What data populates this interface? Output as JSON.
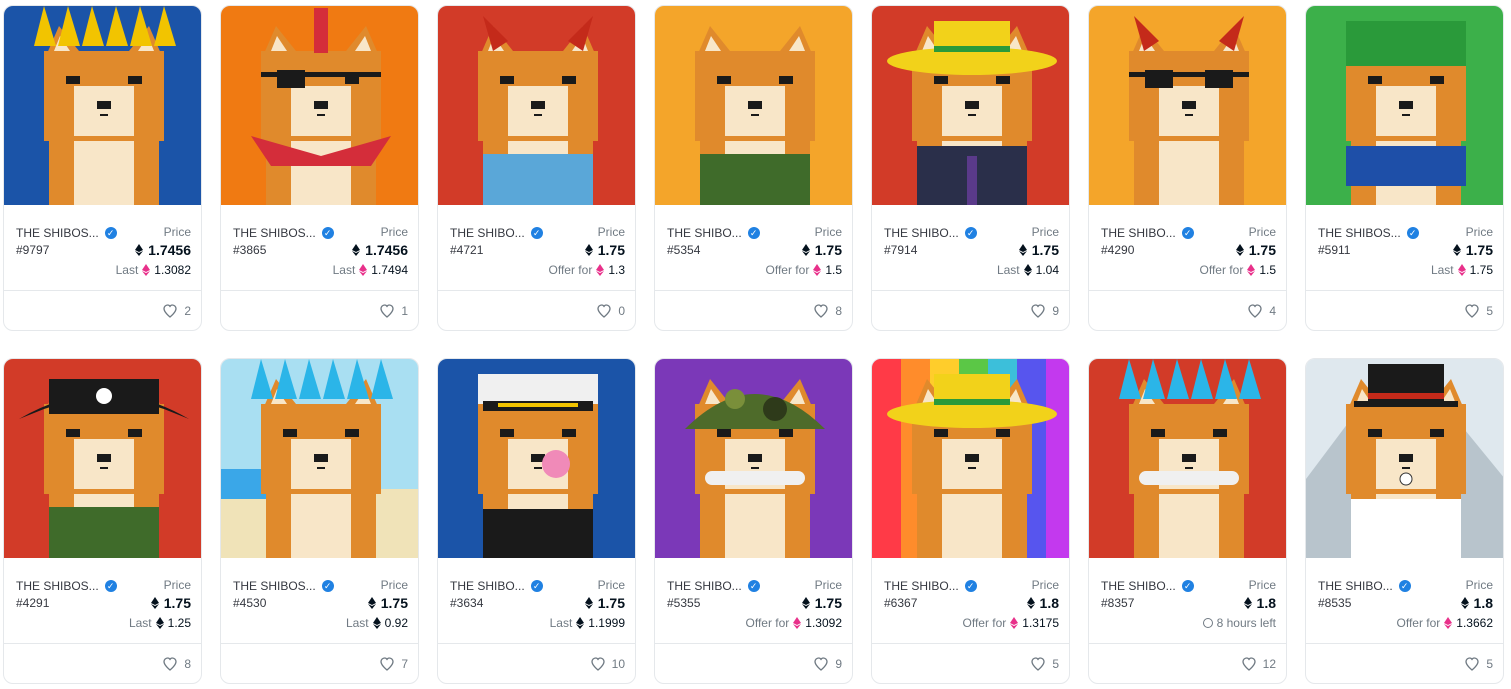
{
  "cards": [
    {
      "collection": "THE SHIBOS...",
      "token": "#9797",
      "price_label": "Price",
      "price": "1.7456",
      "sub_label": "Last",
      "sub_value": "1.3082",
      "sub_icon": "eth-pink-icon",
      "likes": "2",
      "bg": "#1b54a8",
      "art": "blonde-spiky-hair",
      "accent": "#f2c400"
    },
    {
      "collection": "THE SHIBOS...",
      "token": "#3865",
      "price_label": "Price",
      "price": "1.7456",
      "sub_label": "Last",
      "sub_value": "1.7494",
      "sub_icon": "eth-pink-icon",
      "likes": "1",
      "bg": "#f07a12",
      "art": "mohawk-eyepatch",
      "accent": "#d42d3a"
    },
    {
      "collection": "THE SHIBO...",
      "token": "#4721",
      "price_label": "Price",
      "price": "1.75",
      "sub_label": "Offer for",
      "sub_value": "1.3",
      "sub_icon": "eth-pink-icon",
      "likes": "0",
      "bg": "#d23b28",
      "art": "devil-horns-overalls",
      "accent": "#c42a1a"
    },
    {
      "collection": "THE SHIBO...",
      "token": "#5354",
      "price_label": "Price",
      "price": "1.75",
      "sub_label": "Offer for",
      "sub_value": "1.5",
      "sub_icon": "eth-pink-icon",
      "likes": "8",
      "bg": "#f4a52a",
      "art": "vest-kiss-mark",
      "accent": "#3f6b2a"
    },
    {
      "collection": "THE SHIBO...",
      "token": "#7914",
      "price_label": "Price",
      "price": "1.75",
      "sub_label": "Last",
      "sub_value": "1.04",
      "sub_icon": "eth-icon",
      "likes": "9",
      "bg": "#d23b28",
      "art": "sombrero-suit",
      "accent": "#f2d21a"
    },
    {
      "collection": "THE SHIBO...",
      "token": "#4290",
      "price_label": "Price",
      "price": "1.75",
      "sub_label": "Offer for",
      "sub_value": "1.5",
      "sub_icon": "eth-pink-icon",
      "likes": "4",
      "bg": "#f4a52a",
      "art": "devil-horns-mask",
      "accent": "#c42a1a"
    },
    {
      "collection": "THE SHIBOS...",
      "token": "#5911",
      "price_label": "Price",
      "price": "1.75",
      "sub_label": "Last",
      "sub_value": "1.75",
      "sub_icon": "eth-pink-icon",
      "likes": "5",
      "bg": "#3cb04a",
      "art": "green-beanie",
      "accent": "#2a9a3a"
    },
    {
      "collection": "THE SHIBOS...",
      "token": "#4291",
      "price_label": "Price",
      "price": "1.75",
      "sub_label": "Last",
      "sub_value": "1.25",
      "sub_icon": "eth-icon",
      "likes": "8",
      "bg": "#d23b28",
      "art": "pirate-hat-vest",
      "accent": "#1a1a1a"
    },
    {
      "collection": "THE SHIBOS...",
      "token": "#4530",
      "price_label": "Price",
      "price": "1.75",
      "sub_label": "Last",
      "sub_value": "0.92",
      "sub_icon": "eth-icon",
      "likes": "7",
      "bg": "#a9dff2",
      "art": "blue-hair-beach",
      "accent": "#2bb5e8"
    },
    {
      "collection": "THE SHIBO...",
      "token": "#3634",
      "price_label": "Price",
      "price": "1.75",
      "sub_label": "Last",
      "sub_value": "1.1999",
      "sub_icon": "eth-icon",
      "likes": "10",
      "bg": "#1b54a8",
      "art": "captain-hat-bubblegum",
      "accent": "#f0f0f0"
    },
    {
      "collection": "THE SHIBO...",
      "token": "#5355",
      "price_label": "Price",
      "price": "1.75",
      "sub_label": "Offer for",
      "sub_value": "1.3092",
      "sub_icon": "eth-pink-icon",
      "likes": "9",
      "bg": "#7b38b8",
      "art": "camo-helmet-bone",
      "accent": "#4e6b2a"
    },
    {
      "collection": "THE SHIBO...",
      "token": "#6367",
      "price_label": "Price",
      "price": "1.8",
      "sub_label": "Offer for",
      "sub_value": "1.3175",
      "sub_icon": "eth-pink-icon",
      "likes": "5",
      "bg": "#ff3b8a",
      "art": "sombrero-rainbow",
      "accent": "#f2d21a"
    },
    {
      "collection": "THE SHIBO...",
      "token": "#8357",
      "price_label": "Price",
      "price": "1.8",
      "sub_label": "",
      "sub_value": "8 hours left",
      "sub_icon": "clock-icon",
      "likes": "12",
      "bg": "#d23b28",
      "art": "blue-hair-bone",
      "accent": "#2bb5e8"
    },
    {
      "collection": "THE SHIBO...",
      "token": "#8535",
      "price_label": "Price",
      "price": "1.8",
      "sub_label": "Offer for",
      "sub_value": "1.3662",
      "sub_icon": "eth-pink-icon",
      "likes": "5",
      "bg": "#dfe8ee",
      "art": "top-hat-labcoat",
      "accent": "#1a1a1a"
    }
  ]
}
